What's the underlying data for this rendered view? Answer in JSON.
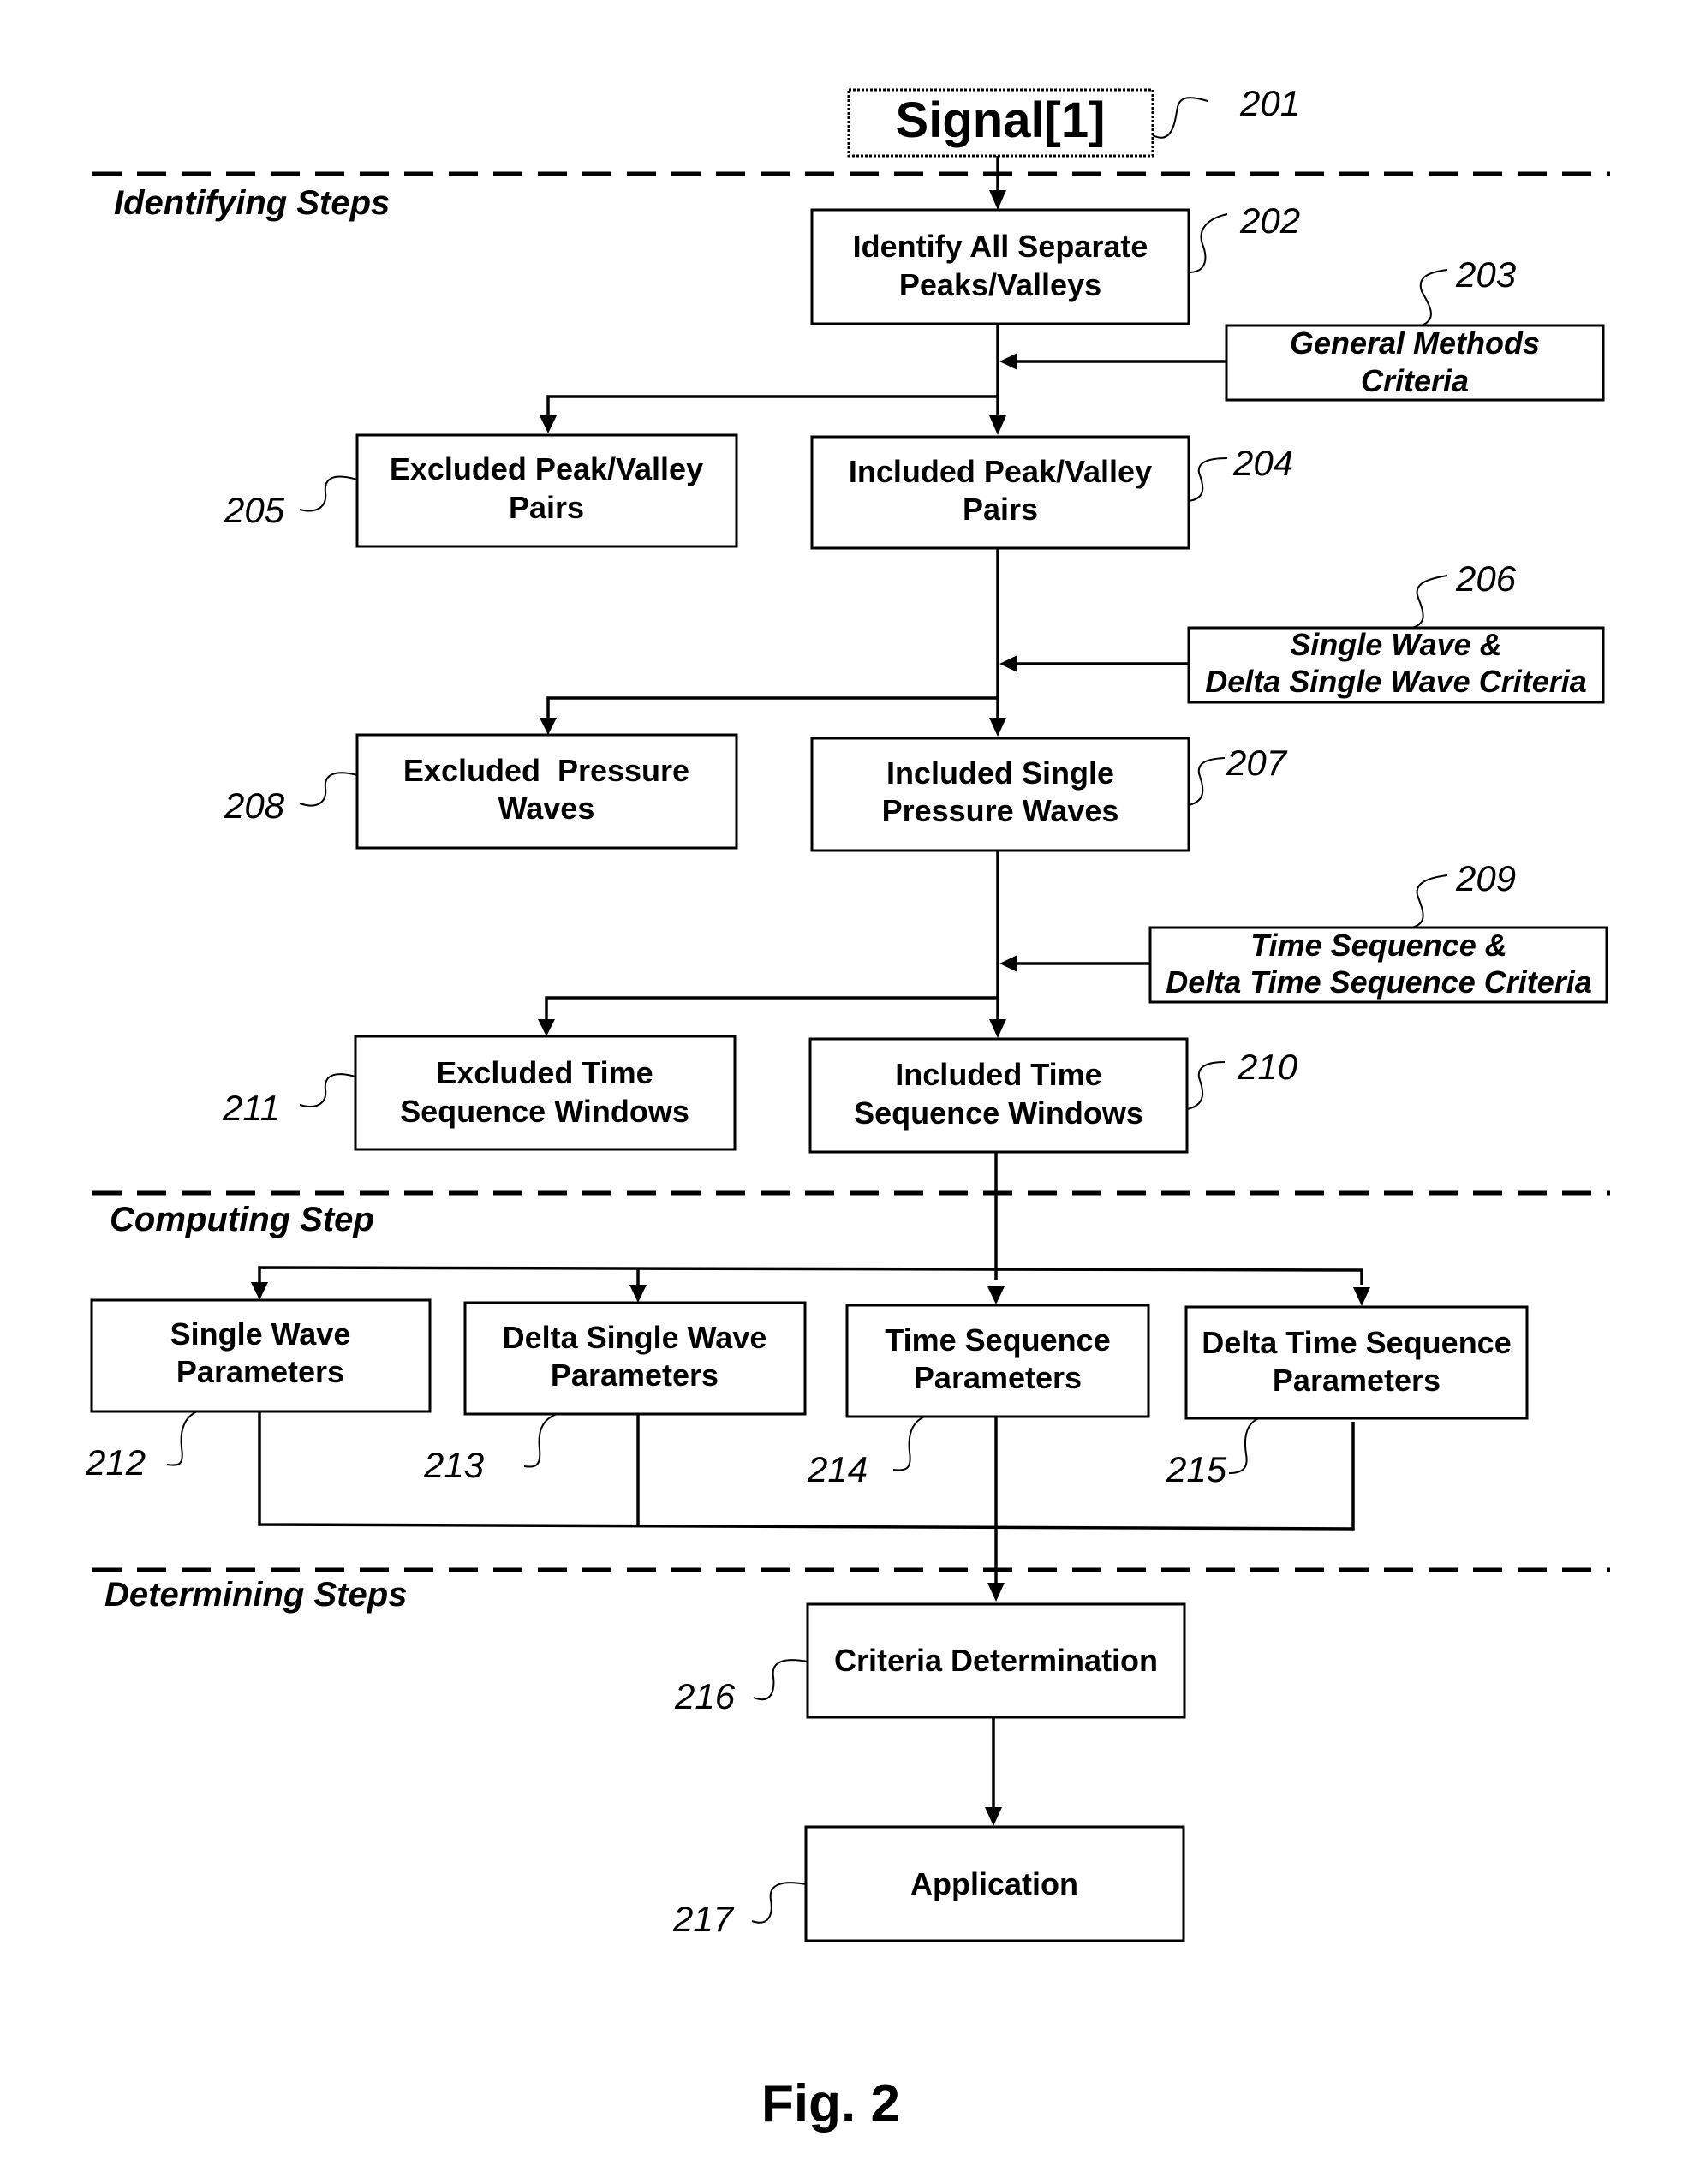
{
  "figure": {
    "caption": "Fig. 2"
  },
  "sections": {
    "identifying": "Identifying Steps",
    "computing": "Computing Step",
    "determining": "Determining Steps"
  },
  "nodes": {
    "signal": {
      "ref": "201",
      "lines": [
        "Signal[1]"
      ]
    },
    "identify": {
      "ref": "202",
      "lines": [
        "Identify All Separate",
        "Peaks/Valleys"
      ]
    },
    "general_criteria": {
      "ref": "203",
      "lines": [
        "General Methods",
        "Criteria"
      ]
    },
    "included_pairs": {
      "ref": "204",
      "lines": [
        "Included Peak/Valley",
        "Pairs"
      ]
    },
    "excluded_pairs": {
      "ref": "205",
      "lines": [
        "Excluded Peak/Valley",
        "Pairs"
      ]
    },
    "single_wave_criteria": {
      "ref": "206",
      "lines": [
        "Single Wave &",
        "Delta Single Wave Criteria"
      ]
    },
    "included_waves": {
      "ref": "207",
      "lines": [
        "Included Single",
        "Pressure Waves"
      ]
    },
    "excluded_waves": {
      "ref": "208",
      "lines": [
        "Excluded  Pressure",
        "Waves"
      ]
    },
    "time_seq_criteria": {
      "ref": "209",
      "lines": [
        "Time Sequence &",
        "Delta Time Sequence Criteria"
      ]
    },
    "included_windows": {
      "ref": "210",
      "lines": [
        "Included Time",
        "Sequence Windows"
      ]
    },
    "excluded_windows": {
      "ref": "211",
      "lines": [
        "Excluded Time",
        "Sequence Windows"
      ]
    },
    "single_wave_params": {
      "ref": "212",
      "lines": [
        "Single Wave",
        "Parameters"
      ]
    },
    "delta_single_wave_params": {
      "ref": "213",
      "lines": [
        "Delta Single Wave",
        "Parameters"
      ]
    },
    "time_seq_params": {
      "ref": "214",
      "lines": [
        "Time Sequence",
        "Parameters"
      ]
    },
    "delta_time_seq_params": {
      "ref": "215",
      "lines": [
        "Delta Time Sequence",
        "Parameters"
      ]
    },
    "criteria_determination": {
      "ref": "216",
      "lines": [
        "Criteria Determination"
      ]
    },
    "application": {
      "ref": "217",
      "lines": [
        "Application"
      ]
    }
  }
}
